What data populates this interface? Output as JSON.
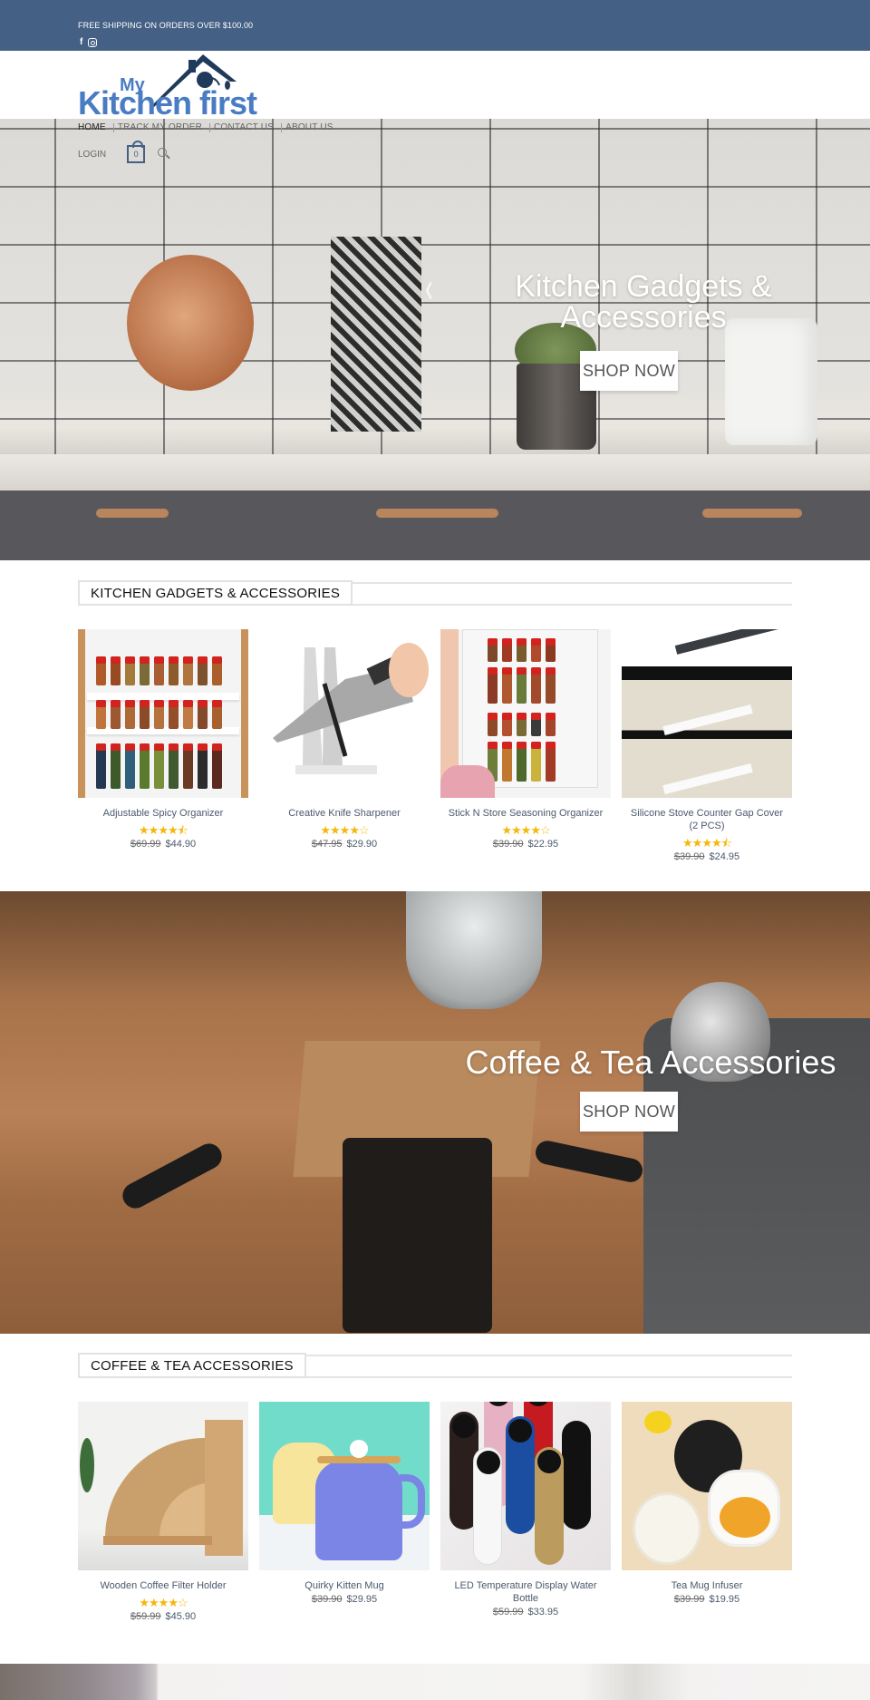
{
  "topbar": {
    "announcement": "FREE SHIPPING ON ORDERS OVER $100.00",
    "social": [
      {
        "icon": "facebook-icon",
        "glyph": "f"
      },
      {
        "icon": "instagram-icon",
        "glyph": ""
      }
    ],
    "background": "#446084"
  },
  "header": {
    "logo": {
      "line1": "My",
      "line2": "Kitchen first",
      "color": "#4a7cc4",
      "roof_color": "#1f3a5a"
    },
    "nav": [
      {
        "label": "HOME",
        "active": true
      },
      {
        "label": "TRACK MY ORDER",
        "active": false
      },
      {
        "label": "CONTACT US",
        "active": false
      },
      {
        "label": "ABOUT US",
        "active": false
      }
    ],
    "login_label": "LOGIN",
    "cart_count": "0"
  },
  "hero_kitchen": {
    "title": "Kitchen Gadgets & Accessories",
    "button_label": "SHOP NOW",
    "prev_glyph": "❬"
  },
  "section_kitchen": {
    "title": "KITCHEN GADGETS & ACCESSORIES",
    "products": [
      {
        "name": "Adjustable Spicy Organizer",
        "rating": 4.5,
        "stars": "★★★★⯪",
        "old_price": "$69.99",
        "price": "$44.90"
      },
      {
        "name": "Creative Knife Sharpener",
        "rating": 4,
        "stars": "★★★★☆",
        "old_price": "$47.95",
        "price": "$29.90"
      },
      {
        "name": "Stick N Store Seasoning Organizer",
        "rating": 4,
        "stars": "★★★★☆",
        "old_price": "$39.90",
        "price": "$22.95"
      },
      {
        "name": "Silicone Stove Counter Gap Cover (2 PCS)",
        "rating": 4.5,
        "stars": "★★★★⯪",
        "old_price": "$39.90",
        "price": "$24.95"
      }
    ]
  },
  "hero_coffee": {
    "title": "Coffee & Tea Accessories",
    "button_label": "SHOP NOW"
  },
  "section_coffee": {
    "title": "COFFEE & TEA ACCESSORIES",
    "products": [
      {
        "name": "Wooden Coffee Filter Holder",
        "rating": 4,
        "stars": "★★★★☆",
        "old_price": "$59.99",
        "price": "$45.90"
      },
      {
        "name": "Quirky Kitten Mug",
        "old_price": "$39.90",
        "price": "$29.95"
      },
      {
        "name": "LED Temperature Display Water Bottle",
        "old_price": "$59.99",
        "price": "$33.95"
      },
      {
        "name": "Tea Mug Infuser",
        "old_price": "$39.99",
        "price": "$19.95"
      }
    ]
  },
  "colors": {
    "accent": "#446084",
    "star": "#f5b70c",
    "product_text": "#4b5a6c"
  }
}
